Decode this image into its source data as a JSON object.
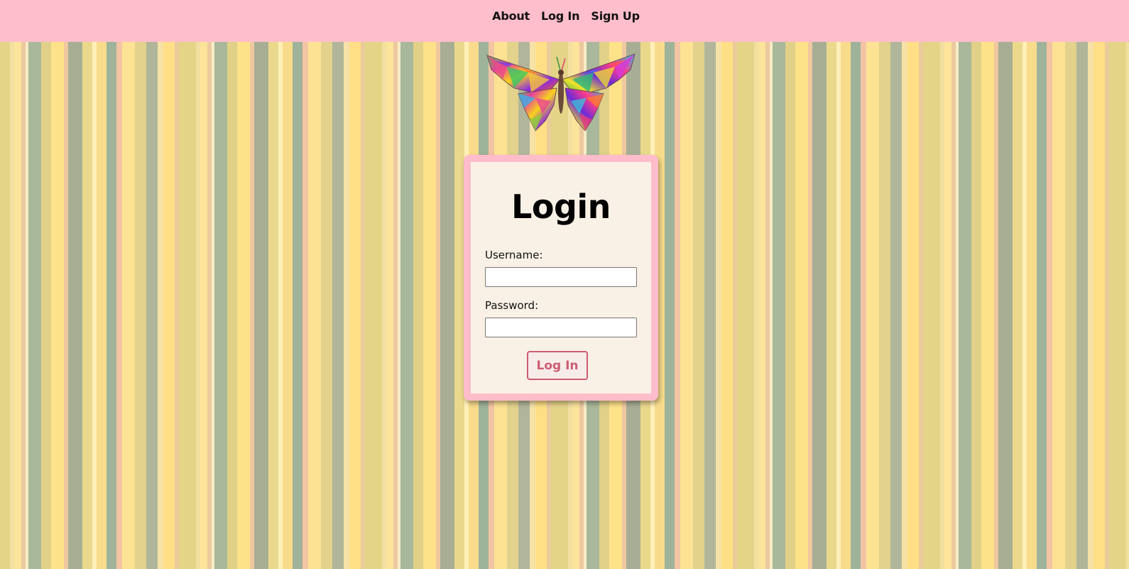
{
  "nav": {
    "items": [
      {
        "label": "About"
      },
      {
        "label": "Log In"
      },
      {
        "label": "Sign Up"
      }
    ]
  },
  "logo": {
    "icon": "butterfly-icon"
  },
  "login": {
    "title": "Login",
    "username_label": "Username:",
    "username_value": "",
    "password_label": "Password:",
    "password_value": "",
    "submit_label": "Log In"
  },
  "colors": {
    "topbar": "#ffbecb",
    "card_border": "#ffbcca",
    "card_background": "#faf1e6",
    "accent": "#cc5c72"
  }
}
